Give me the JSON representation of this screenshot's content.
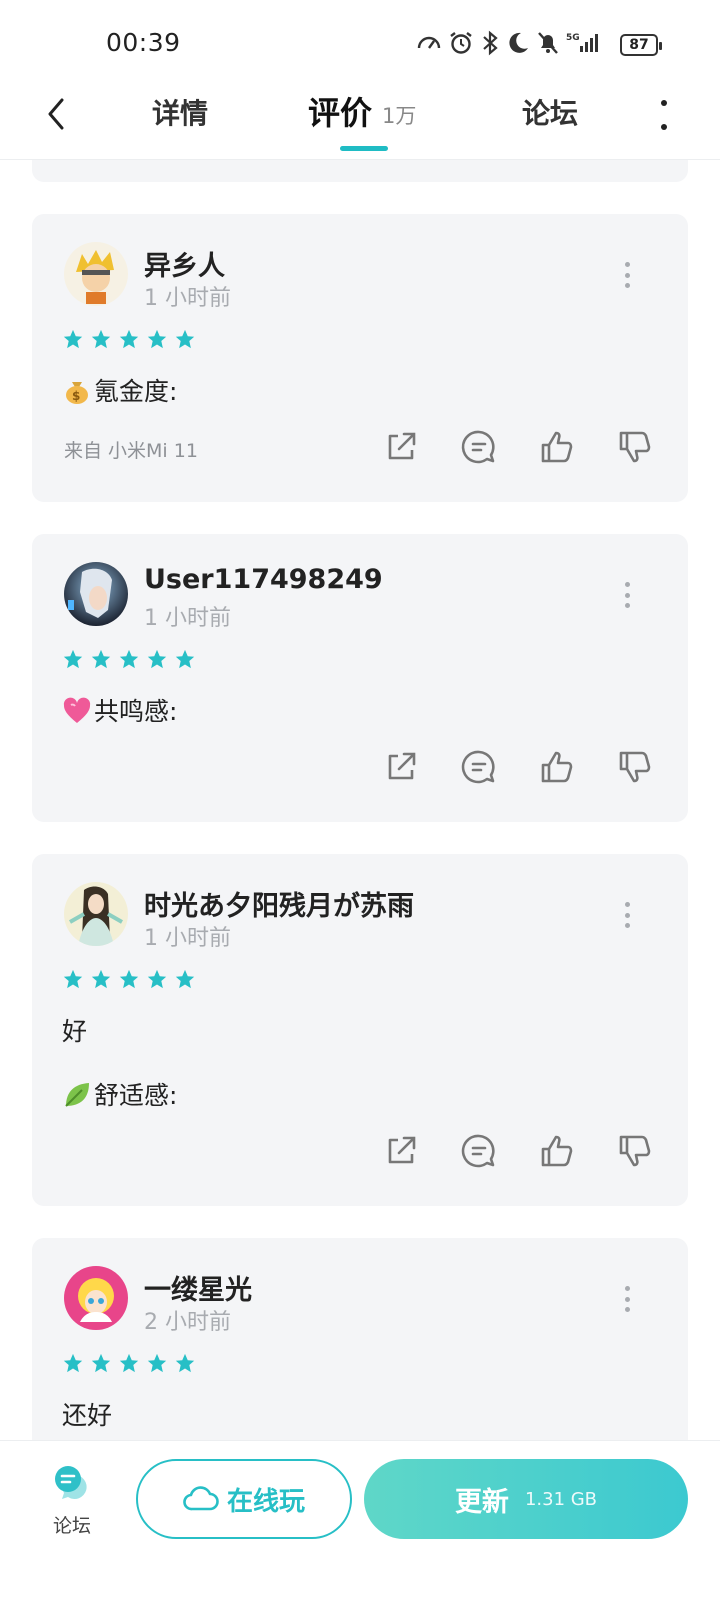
{
  "status": {
    "time": "00:39",
    "battery": "87",
    "network": "5G"
  },
  "nav": {
    "tabs": [
      {
        "label": "详情"
      },
      {
        "label": "评价",
        "count": "1万"
      },
      {
        "label": "论坛"
      }
    ]
  },
  "reviews": [
    {
      "username": "异乡人",
      "time": "1 小时前",
      "rating": 5,
      "lines": [
        "氪金度:"
      ],
      "device": "来自 小米Mi 11"
    },
    {
      "username": "User117498249",
      "time": "1 小时前",
      "rating": 5,
      "lines": [
        "共鸣感:"
      ]
    },
    {
      "username": "时光あ夕阳残月が苏雨",
      "time": "1 小时前",
      "rating": 5,
      "lines": [
        "好",
        "舒适感:"
      ]
    },
    {
      "username": "一缕星光",
      "time": "2 小时前",
      "rating": 5,
      "lines": [
        "还好"
      ]
    }
  ],
  "bottom": {
    "forum_label": "论坛",
    "play_online_label": "在线玩",
    "update_label": "更新",
    "update_size": "1.31 GB"
  },
  "colors": {
    "accent": "#1fbcc4",
    "star": "#27bfc6",
    "card_bg": "#f4f5f7",
    "update_gradient_start": "#5fd7c8",
    "update_gradient_end": "#3cc9d0"
  },
  "icons": [
    "back-arrow-icon",
    "more-vertical-icon",
    "star-icon",
    "share-icon",
    "comment-icon",
    "thumbs-up-icon",
    "thumbs-down-icon",
    "forum-chat-icon",
    "cloud-icon"
  ]
}
